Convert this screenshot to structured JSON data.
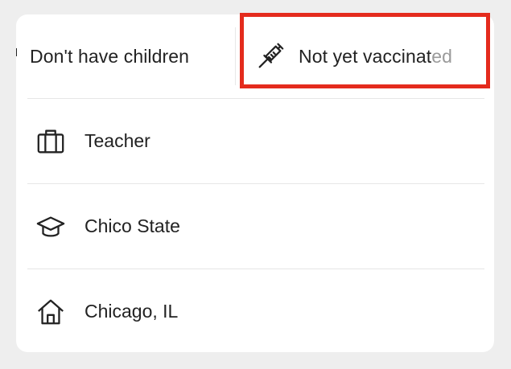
{
  "chips": {
    "children_label": "Don't have children",
    "vaccine_label_main": "Not yet vaccinat",
    "vaccine_label_fade": "ed",
    "vaccine_icon": "syringe-icon"
  },
  "details": [
    {
      "label": "Teacher",
      "icon": "briefcase-icon"
    },
    {
      "label": "Chico State",
      "icon": "graduation-cap-icon"
    },
    {
      "label": "Chicago, IL",
      "icon": "home-icon"
    }
  ],
  "colors": {
    "highlight": "#e42b1d",
    "text": "#222222",
    "background": "#ffffff"
  }
}
